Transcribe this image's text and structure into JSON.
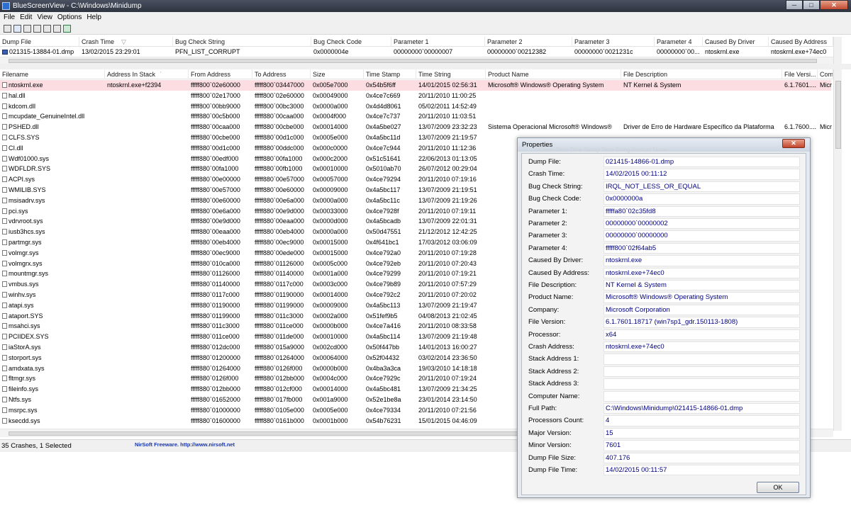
{
  "window": {
    "title": "BlueScreenView  -  C:\\Windows\\Minidump",
    "controls": [
      "─",
      "□",
      "✕"
    ]
  },
  "menu": [
    "File",
    "Edit",
    "View",
    "Options",
    "Help"
  ],
  "toolbar": [
    "save-icon",
    "properties-icon",
    "copy-icon",
    "html-report-icon",
    "advanced-options-icon",
    "find-icon",
    "exit-icon"
  ],
  "crash_list": {
    "columns": [
      "Dump File",
      "Crash Time",
      "Bug Check String",
      "Bug Check Code",
      "Parameter 1",
      "Parameter 2",
      "Parameter 3",
      "Parameter 4",
      "Caused By Driver",
      "Caused By Address"
    ],
    "rows": [
      [
        "021315-13884-01.dmp",
        "13/02/2015 23:29:01",
        "PFN_LIST_CORRUPT",
        "0x0000004e",
        "00000000`00000007",
        "00000000`00212382",
        "00000000`0021231c",
        "00000000`00...",
        "ntoskrnl.exe",
        "ntoskrnl.exe+74ec0"
      ]
    ]
  },
  "driver_list": {
    "columns": [
      "Filename",
      "Address In Stack",
      "From Address",
      "To Address",
      "Size",
      "Time Stamp",
      "Time String",
      "Product Name",
      "File Description",
      "File Versi...",
      "Com"
    ],
    "rows": [
      [
        "ntoskrnl.exe",
        "ntoskrnl.exe+f2394",
        "fffff800`02e60000",
        "fffff800`03447000",
        "0x005e7000",
        "0x54b5f6ff",
        "14/01/2015 02:56:31",
        "Microsoft® Windows® Operating System",
        "NT Kernel & System",
        "6.1.7601....",
        "Micr"
      ],
      [
        "hal.dll",
        "",
        "fffff800`02e17000",
        "fffff800`02e60000",
        "0x00049000",
        "0x4ce7c669",
        "20/11/2010 11:00:25",
        "",
        "",
        "",
        ""
      ],
      [
        "kdcom.dll",
        "",
        "fffff800`00bb9000",
        "fffff800`00bc3000",
        "0x0000a000",
        "0x4d4d8061",
        "05/02/2011 14:52:49",
        "",
        "",
        "",
        ""
      ],
      [
        "mcupdate_GenuineIntel.dll",
        "",
        "fffff880`00c5b000",
        "fffff880`00caa000",
        "0x0004f000",
        "0x4ce7c737",
        "20/11/2010 11:03:51",
        "",
        "",
        "",
        ""
      ],
      [
        "PSHED.dll",
        "",
        "fffff880`00caa000",
        "fffff880`00cbe000",
        "0x00014000",
        "0x4a5be027",
        "13/07/2009 23:32:23",
        "Sistema Operacional Microsoft® Windows®",
        "Driver de Erro de Hardware Específico da Plataforma",
        "6.1.7600....",
        "Micr"
      ],
      [
        "CLFS.SYS",
        "",
        "fffff880`00cbe000",
        "fffff880`00d1c000",
        "0x0005e000",
        "0x4a5bc11d",
        "13/07/2009 21:19:57",
        "",
        "",
        "",
        ""
      ],
      [
        "CI.dll",
        "",
        "fffff880`00d1c000",
        "fffff880`00ddc000",
        "0x000c0000",
        "0x4ce7c944",
        "20/11/2010 11:12:36",
        "",
        "",
        "",
        ""
      ],
      [
        "Wdf01000.sys",
        "",
        "fffff880`00edf000",
        "fffff880`00fa1000",
        "0x000c2000",
        "0x51c51641",
        "22/06/2013 01:13:05",
        "",
        "",
        "",
        ""
      ],
      [
        "WDFLDR.SYS",
        "",
        "fffff880`00fa1000",
        "fffff880`00fb1000",
        "0x00010000",
        "0x5010ab70",
        "26/07/2012 00:29:04",
        "",
        "",
        "",
        ""
      ],
      [
        "ACPI.sys",
        "",
        "fffff880`00e00000",
        "fffff880`00e57000",
        "0x00057000",
        "0x4ce79294",
        "20/11/2010 07:19:16",
        "",
        "",
        "",
        ""
      ],
      [
        "WMILIB.SYS",
        "",
        "fffff880`00e57000",
        "fffff880`00e60000",
        "0x00009000",
        "0x4a5bc117",
        "13/07/2009 21:19:51",
        "",
        "",
        "",
        ""
      ],
      [
        "msisadrv.sys",
        "",
        "fffff880`00e60000",
        "fffff880`00e6a000",
        "0x0000a000",
        "0x4a5bc11c",
        "13/07/2009 21:19:26",
        "",
        "",
        "",
        ""
      ],
      [
        "pci.sys",
        "",
        "fffff880`00e6a000",
        "fffff880`00e9d000",
        "0x00033000",
        "0x4ce7928f",
        "20/11/2010 07:19:11",
        "",
        "",
        "",
        ""
      ],
      [
        "vdrvroot.sys",
        "",
        "fffff880`00e9d000",
        "fffff880`00eaa000",
        "0x0000d000",
        "0x4a5bcadb",
        "13/07/2009 22:01:31",
        "",
        "",
        "",
        ""
      ],
      [
        "iusb3hcs.sys",
        "",
        "fffff880`00eaa000",
        "fffff880`00eb4000",
        "0x0000a000",
        "0x50d47551",
        "21/12/2012 12:42:25",
        "",
        "",
        "",
        ""
      ],
      [
        "partmgr.sys",
        "",
        "fffff880`00eb4000",
        "fffff880`00ec9000",
        "0x00015000",
        "0x4f641bc1",
        "17/03/2012 03:06:09",
        "",
        "",
        "",
        ""
      ],
      [
        "volmgr.sys",
        "",
        "fffff880`00ec9000",
        "fffff880`00ede000",
        "0x00015000",
        "0x4ce792a0",
        "20/11/2010 07:19:28",
        "",
        "",
        "",
        ""
      ],
      [
        "volmgrx.sys",
        "",
        "fffff880`010ca000",
        "fffff880`01126000",
        "0x0005c000",
        "0x4ce792eb",
        "20/11/2010 07:20:43",
        "",
        "",
        "",
        ""
      ],
      [
        "mountmgr.sys",
        "",
        "fffff880`01126000",
        "fffff880`01140000",
        "0x0001a000",
        "0x4ce79299",
        "20/11/2010 07:19:21",
        "",
        "",
        "",
        ""
      ],
      [
        "vmbus.sys",
        "",
        "fffff880`01140000",
        "fffff880`0117c000",
        "0x0003c000",
        "0x4ce79b89",
        "20/11/2010 07:57:29",
        "",
        "",
        "",
        ""
      ],
      [
        "winhv.sys",
        "",
        "fffff880`0117c000",
        "fffff880`01190000",
        "0x00014000",
        "0x4ce792c2",
        "20/11/2010 07:20:02",
        "",
        "",
        "",
        ""
      ],
      [
        "atapi.sys",
        "",
        "fffff880`01190000",
        "fffff880`01199000",
        "0x00009000",
        "0x4a5bc113",
        "13/07/2009 21:19:47",
        "",
        "",
        "",
        ""
      ],
      [
        "ataport.SYS",
        "",
        "fffff880`01199000",
        "fffff880`011c3000",
        "0x0002a000",
        "0x51fef9b5",
        "04/08/2013 21:02:45",
        "",
        "",
        "",
        ""
      ],
      [
        "msahci.sys",
        "",
        "fffff880`011c3000",
        "fffff880`011ce000",
        "0x0000b000",
        "0x4ce7a416",
        "20/11/2010 08:33:58",
        "",
        "",
        "",
        ""
      ],
      [
        "PCIIDEX.SYS",
        "",
        "fffff880`011ce000",
        "fffff880`011de000",
        "0x00010000",
        "0x4a5bc114",
        "13/07/2009 21:19:48",
        "",
        "",
        "",
        ""
      ],
      [
        "iaStorA.sys",
        "",
        "fffff880`012dc000",
        "fffff880`015a9000",
        "0x002cd000",
        "0x50f447bb",
        "14/01/2013 16:00:27",
        "",
        "",
        "",
        ""
      ],
      [
        "storport.sys",
        "",
        "fffff880`01200000",
        "fffff880`01264000",
        "0x00064000",
        "0x52f04432",
        "03/02/2014 23:36:50",
        "",
        "",
        "",
        ""
      ],
      [
        "amdxata.sys",
        "",
        "fffff880`01264000",
        "fffff880`0126f000",
        "0x0000b000",
        "0x4ba3a3ca",
        "19/03/2010 14:18:18",
        "",
        "",
        "",
        ""
      ],
      [
        "fltmgr.sys",
        "",
        "fffff880`0126f000",
        "fffff880`012bb000",
        "0x0004c000",
        "0x4ce7929c",
        "20/11/2010 07:19:24",
        "",
        "",
        "",
        ""
      ],
      [
        "fileinfo.sys",
        "",
        "fffff880`012bb000",
        "fffff880`012cf000",
        "0x00014000",
        "0x4a5bc481",
        "13/07/2009 21:34:25",
        "",
        "",
        "",
        ""
      ],
      [
        "Ntfs.sys",
        "",
        "fffff880`01652000",
        "fffff880`017fb000",
        "0x001a9000",
        "0x52e1be8a",
        "23/01/2014 23:14:50",
        "",
        "",
        "",
        ""
      ],
      [
        "msrpc.sys",
        "",
        "fffff880`01000000",
        "fffff880`0105e000",
        "0x0005e000",
        "0x4ce79334",
        "20/11/2010 07:21:56",
        "",
        "",
        "",
        ""
      ],
      [
        "ksecdd.sys",
        "",
        "fffff880`01600000",
        "fffff880`0161b000",
        "0x0001b000",
        "0x54b76231",
        "15/01/2015 04:46:09",
        "",
        "",
        "",
        ""
      ]
    ]
  },
  "status": {
    "left": "35 Crashes, 1 Selected",
    "link": "NirSoft Freeware.  http://www.nirsoft.net"
  },
  "properties": {
    "title": "Properties",
    "close": "✕",
    "ok_label": "OK",
    "ghost_header": "Crash Time       Time Stamp       Time String           Product Name",
    "fields": [
      {
        "label": "Dump File:",
        "value": "021415-14866-01.dmp"
      },
      {
        "label": "Crash Time:",
        "value": "14/02/2015 00:11:12"
      },
      {
        "label": "Bug Check String:",
        "value": "IRQL_NOT_LESS_OR_EQUAL"
      },
      {
        "label": "Bug Check Code:",
        "value": "0x0000000a"
      },
      {
        "label": "Parameter 1:",
        "value": "fffffa80`02c35fd8"
      },
      {
        "label": "Parameter 2:",
        "value": "00000000`00000002"
      },
      {
        "label": "Parameter 3:",
        "value": "00000000`00000000"
      },
      {
        "label": "Parameter 4:",
        "value": "fffff800`02f64ab5"
      },
      {
        "label": "Caused By Driver:",
        "value": "ntoskrnl.exe"
      },
      {
        "label": "Caused By Address:",
        "value": "ntoskrnl.exe+74ec0"
      },
      {
        "label": "File Description:",
        "value": "NT Kernel & System"
      },
      {
        "label": "Product Name:",
        "value": "Microsoft® Windows® Operating System"
      },
      {
        "label": "Company:",
        "value": "Microsoft Corporation"
      },
      {
        "label": "File Version:",
        "value": "6.1.7601.18717 (win7sp1_gdr.150113-1808)"
      },
      {
        "label": "Processor:",
        "value": "x64"
      },
      {
        "label": "Crash Address:",
        "value": "ntoskrnl.exe+74ec0"
      },
      {
        "label": "Stack Address 1:",
        "value": ""
      },
      {
        "label": "Stack Address 2:",
        "value": ""
      },
      {
        "label": "Stack Address 3:",
        "value": ""
      },
      {
        "label": "Computer Name:",
        "value": ""
      },
      {
        "label": "Full Path:",
        "value": "C:\\Windows\\Minidump\\021415-14866-01.dmp"
      },
      {
        "label": "Processors Count:",
        "value": "4"
      },
      {
        "label": "Major Version:",
        "value": "15"
      },
      {
        "label": "Minor Version:",
        "value": "7601"
      },
      {
        "label": "Dump File Size:",
        "value": "407.176"
      },
      {
        "label": "Dump File Time:",
        "value": "14/02/2015 00:11:57"
      }
    ]
  }
}
